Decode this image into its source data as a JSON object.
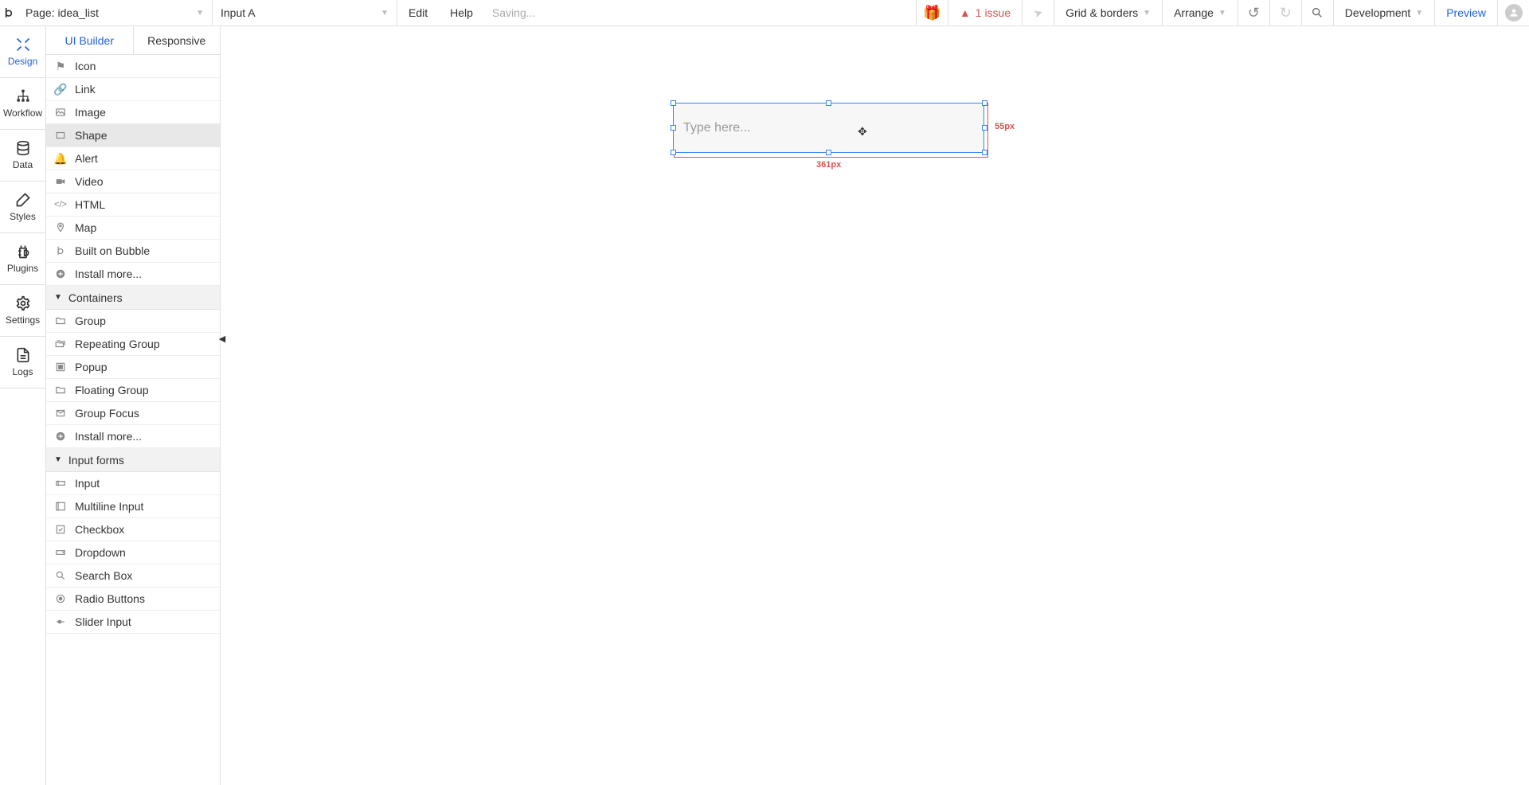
{
  "topbar": {
    "page_selector_label": "Page: idea_list",
    "element_selector_label": "Input A",
    "edit_label": "Edit",
    "help_label": "Help",
    "status": "Saving...",
    "issues_label": "1 issue",
    "grid_label": "Grid & borders",
    "arrange_label": "Arrange",
    "env_label": "Development",
    "preview_label": "Preview"
  },
  "rail": [
    {
      "id": "design",
      "label": "Design"
    },
    {
      "id": "workflow",
      "label": "Workflow"
    },
    {
      "id": "data",
      "label": "Data"
    },
    {
      "id": "styles",
      "label": "Styles"
    },
    {
      "id": "plugins",
      "label": "Plugins"
    },
    {
      "id": "settings",
      "label": "Settings"
    },
    {
      "id": "logs",
      "label": "Logs"
    }
  ],
  "palette_tabs": {
    "ui_builder": "UI Builder",
    "responsive": "Responsive"
  },
  "palette": {
    "visual_items": [
      {
        "id": "icon",
        "label": "Icon"
      },
      {
        "id": "link",
        "label": "Link"
      },
      {
        "id": "image",
        "label": "Image"
      },
      {
        "id": "shape",
        "label": "Shape"
      },
      {
        "id": "alert",
        "label": "Alert"
      },
      {
        "id": "video",
        "label": "Video"
      },
      {
        "id": "html",
        "label": "HTML"
      },
      {
        "id": "map",
        "label": "Map"
      },
      {
        "id": "built",
        "label": "Built on Bubble"
      },
      {
        "id": "install1",
        "label": "Install more..."
      }
    ],
    "section_containers": "Containers",
    "containers_items": [
      {
        "id": "group",
        "label": "Group"
      },
      {
        "id": "rgroup",
        "label": "Repeating Group"
      },
      {
        "id": "popup",
        "label": "Popup"
      },
      {
        "id": "fgroup",
        "label": "Floating Group"
      },
      {
        "id": "gfocus",
        "label": "Group Focus"
      },
      {
        "id": "install2",
        "label": "Install more..."
      }
    ],
    "section_inputs": "Input forms",
    "inputs_items": [
      {
        "id": "input",
        "label": "Input"
      },
      {
        "id": "mlinput",
        "label": "Multiline Input"
      },
      {
        "id": "checkbox",
        "label": "Checkbox"
      },
      {
        "id": "dropdown",
        "label": "Dropdown"
      },
      {
        "id": "searchbox",
        "label": "Search Box"
      },
      {
        "id": "radio",
        "label": "Radio Buttons"
      },
      {
        "id": "slider",
        "label": "Slider Input"
      }
    ]
  },
  "canvas": {
    "placeholder": "Type here...",
    "width_label": "361px",
    "height_label": "55px"
  }
}
